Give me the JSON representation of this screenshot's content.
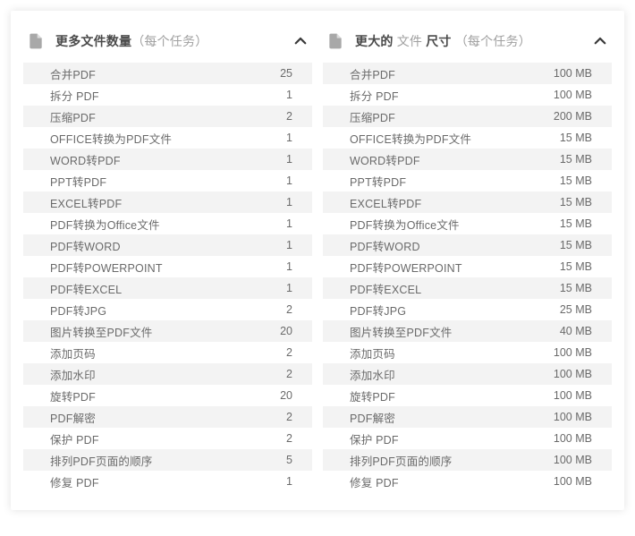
{
  "panels": [
    {
      "header": {
        "bold1": "更多文件数量",
        "light": "（每个任务）",
        "bold2": ""
      },
      "rows": [
        {
          "label": "合并PDF",
          "value": "25"
        },
        {
          "label": "拆分 PDF",
          "value": "1"
        },
        {
          "label": "压缩PDF",
          "value": "2"
        },
        {
          "label": "OFFICE转换为PDF文件",
          "value": "1"
        },
        {
          "label": "WORD转PDF",
          "value": "1"
        },
        {
          "label": "PPT转PDF",
          "value": "1"
        },
        {
          "label": "EXCEL转PDF",
          "value": "1"
        },
        {
          "label": "PDF转换为Office文件",
          "value": "1"
        },
        {
          "label": "PDF转WORD",
          "value": "1"
        },
        {
          "label": "PDF转POWERPOINT",
          "value": "1"
        },
        {
          "label": "PDF转EXCEL",
          "value": "1"
        },
        {
          "label": "PDF转JPG",
          "value": "2"
        },
        {
          "label": "图片转换至PDF文件",
          "value": "20"
        },
        {
          "label": "添加页码",
          "value": "2"
        },
        {
          "label": "添加水印",
          "value": "2"
        },
        {
          "label": "旋转PDF",
          "value": "20"
        },
        {
          "label": "PDF解密",
          "value": "2"
        },
        {
          "label": "保护 PDF",
          "value": "2"
        },
        {
          "label": "排列PDF页面的顺序",
          "value": "5"
        },
        {
          "label": "修复 PDF",
          "value": "1"
        }
      ]
    },
    {
      "header": {
        "bold1": "更大的",
        "light1": " 文件 ",
        "bold2": "尺寸",
        "light2": " （每个任务）"
      },
      "rows": [
        {
          "label": "合并PDF",
          "value": "100 MB"
        },
        {
          "label": "拆分 PDF",
          "value": "100 MB"
        },
        {
          "label": "压缩PDF",
          "value": "200 MB"
        },
        {
          "label": "OFFICE转换为PDF文件",
          "value": "15 MB"
        },
        {
          "label": "WORD转PDF",
          "value": "15 MB"
        },
        {
          "label": "PPT转PDF",
          "value": "15 MB"
        },
        {
          "label": "EXCEL转PDF",
          "value": "15 MB"
        },
        {
          "label": "PDF转换为Office文件",
          "value": "15 MB"
        },
        {
          "label": "PDF转WORD",
          "value": "15 MB"
        },
        {
          "label": "PDF转POWERPOINT",
          "value": "15 MB"
        },
        {
          "label": "PDF转EXCEL",
          "value": "15 MB"
        },
        {
          "label": "PDF转JPG",
          "value": "25 MB"
        },
        {
          "label": "图片转换至PDF文件",
          "value": "40 MB"
        },
        {
          "label": "添加页码",
          "value": "100 MB"
        },
        {
          "label": "添加水印",
          "value": "100 MB"
        },
        {
          "label": "旋转PDF",
          "value": "100 MB"
        },
        {
          "label": "PDF解密",
          "value": "100 MB"
        },
        {
          "label": "保护 PDF",
          "value": "100 MB"
        },
        {
          "label": "排列PDF页面的顺序",
          "value": "100 MB"
        },
        {
          "label": "修复 PDF",
          "value": "100 MB"
        }
      ]
    }
  ]
}
